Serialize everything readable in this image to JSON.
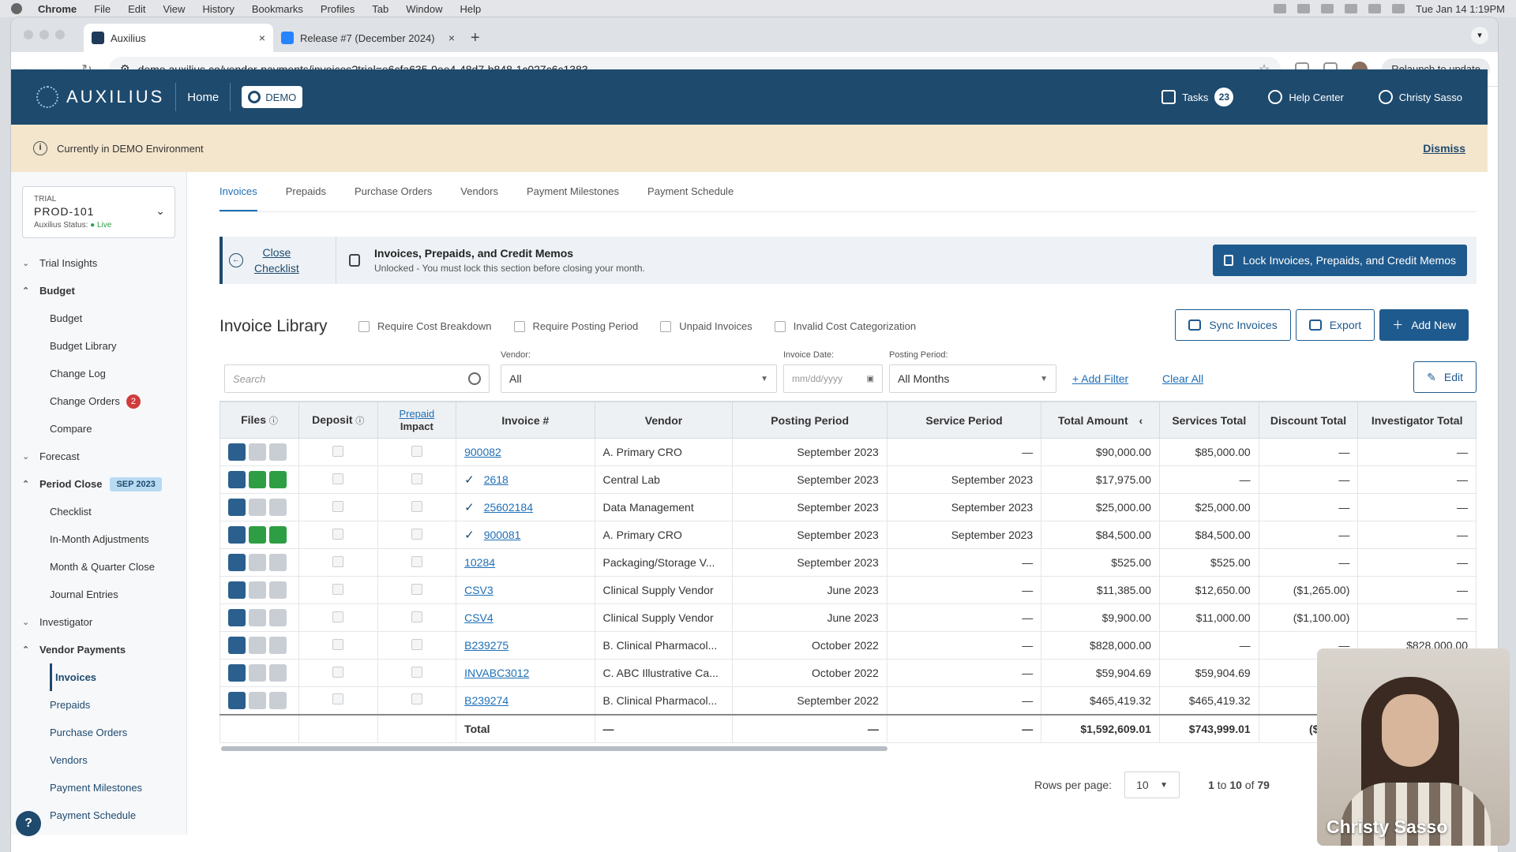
{
  "menubar": {
    "app": "Chrome",
    "items": [
      "File",
      "Edit",
      "View",
      "History",
      "Bookmarks",
      "Profiles",
      "Tab",
      "Window",
      "Help"
    ],
    "clock": "Tue Jan 14  1:19PM"
  },
  "browser": {
    "tabs": [
      {
        "title": "Auxilius",
        "close": "×"
      },
      {
        "title": "Release #7 (December 2024)",
        "close": "×"
      }
    ],
    "new_tab": "+",
    "url": "demo.auxilius.co/vendor-payments/invoices?trial=e6cfa635-9ee4-48d7-b848-1c027c6c1383",
    "relaunch": "Relaunch to update"
  },
  "header": {
    "logo": "AUXILIUS",
    "home": "Home",
    "demo": "DEMO",
    "tasks_label": "Tasks",
    "tasks_count": "23",
    "help": "Help Center",
    "user": "Christy Sasso"
  },
  "banner": {
    "text": "Currently in DEMO Environment",
    "dismiss": "Dismiss"
  },
  "sidebar": {
    "trial_label": "TRIAL",
    "trial_name": "PROD-101",
    "status_label": "Auxilius Status:",
    "status_value": "Live",
    "items": {
      "trial_insights": "Trial Insights",
      "budget": "Budget",
      "budget_sub": "Budget",
      "budget_library": "Budget Library",
      "change_log": "Change Log",
      "change_orders": "Change Orders",
      "change_orders_count": "2",
      "compare": "Compare",
      "forecast": "Forecast",
      "period_close": "Period Close",
      "period_badge": "SEP 2023",
      "checklist": "Checklist",
      "in_month": "In-Month Adjustments",
      "month_quarter": "Month & Quarter Close",
      "journal": "Journal Entries",
      "investigator": "Investigator",
      "vendor_payments": "Vendor Payments",
      "invoices": "Invoices",
      "prepaids": "Prepaids",
      "purchase_orders": "Purchase Orders",
      "vendors": "Vendors",
      "payment_milestones": "Payment Milestones",
      "payment_schedule": "Payment Schedule"
    },
    "help": "?"
  },
  "subtabs": [
    "Invoices",
    "Prepaids",
    "Purchase Orders",
    "Vendors",
    "Payment Milestones",
    "Payment Schedule"
  ],
  "lockbar": {
    "close_line1": "Close",
    "close_line2": "Checklist",
    "title": "Invoices, Prepaids, and Credit Memos",
    "subtitle": "Unlocked - You must lock this section before closing your month.",
    "button": "Lock Invoices, Prepaids, and Credit Memos"
  },
  "library": {
    "title": "Invoice Library",
    "checks": [
      "Require Cost Breakdown",
      "Require Posting Period",
      "Unpaid Invoices",
      "Invalid Cost Categorization"
    ],
    "sync": "Sync Invoices",
    "export": "Export",
    "add_new": "Add New",
    "edit": "Edit"
  },
  "filters": {
    "search_placeholder": "Search",
    "vendor_label": "Vendor:",
    "vendor_value": "All",
    "invoice_date_label": "Invoice Date:",
    "invoice_date_placeholder": "mm/dd/yyyy",
    "posting_label": "Posting Period:",
    "posting_value": "All Months",
    "add_filter": "+ Add Filter",
    "clear_all": "Clear All"
  },
  "table": {
    "columns": {
      "files": "Files",
      "deposit": "Deposit",
      "prepaid": "Prepaid",
      "impact": "Impact",
      "invoice": "Invoice #",
      "vendor": "Vendor",
      "posting": "Posting Period",
      "service": "Service Period",
      "total": "Total Amount",
      "services": "Services Total",
      "discount": "Discount Total",
      "investigator": "Investigator Total"
    },
    "rows": [
      {
        "dl": false,
        "csv": false,
        "checked": false,
        "invoice": "900082",
        "vendor": "A. Primary CRO",
        "posting": "September 2023",
        "service": "—",
        "total": "$90,000.00",
        "services": "$85,000.00",
        "discount": "—",
        "investigator": "—"
      },
      {
        "dl": true,
        "csv": true,
        "checked": true,
        "invoice": "2618",
        "vendor": "Central Lab",
        "posting": "September 2023",
        "service": "September 2023",
        "total": "$17,975.00",
        "services": "—",
        "discount": "—",
        "investigator": "—"
      },
      {
        "dl": false,
        "csv": false,
        "checked": true,
        "invoice": "25602184",
        "vendor": "Data Management",
        "posting": "September 2023",
        "service": "September 2023",
        "total": "$25,000.00",
        "services": "$25,000.00",
        "discount": "—",
        "investigator": "—"
      },
      {
        "dl": true,
        "csv": true,
        "checked": true,
        "invoice": "900081",
        "vendor": "A. Primary CRO",
        "posting": "September 2023",
        "service": "September 2023",
        "total": "$84,500.00",
        "services": "$84,500.00",
        "discount": "—",
        "investigator": "—"
      },
      {
        "dl": false,
        "csv": false,
        "checked": false,
        "invoice": "10284",
        "vendor": "Packaging/Storage V...",
        "posting": "September 2023",
        "service": "—",
        "total": "$525.00",
        "services": "$525.00",
        "discount": "—",
        "investigator": "—"
      },
      {
        "dl": false,
        "csv": false,
        "checked": false,
        "invoice": "CSV3",
        "vendor": "Clinical Supply Vendor",
        "posting": "June 2023",
        "service": "—",
        "total": "$11,385.00",
        "services": "$12,650.00",
        "discount": "($1,265.00)",
        "investigator": "—"
      },
      {
        "dl": false,
        "csv": false,
        "checked": false,
        "invoice": "CSV4",
        "vendor": "Clinical Supply Vendor",
        "posting": "June 2023",
        "service": "—",
        "total": "$9,900.00",
        "services": "$11,000.00",
        "discount": "($1,100.00)",
        "investigator": "—"
      },
      {
        "dl": false,
        "csv": false,
        "checked": false,
        "invoice": "B239275",
        "vendor": "B. Clinical Pharmacol...",
        "posting": "October 2022",
        "service": "—",
        "total": "$828,000.00",
        "services": "—",
        "discount": "—",
        "investigator": "$828,000.00"
      },
      {
        "dl": false,
        "csv": false,
        "checked": false,
        "invoice": "INVABC3012",
        "vendor": "C. ABC Illustrative Ca...",
        "posting": "October 2022",
        "service": "—",
        "total": "$59,904.69",
        "services": "$59,904.69",
        "discount": "",
        "investigator": ""
      },
      {
        "dl": false,
        "csv": false,
        "checked": false,
        "invoice": "B239274",
        "vendor": "B. Clinical Pharmacol...",
        "posting": "September 2022",
        "service": "—",
        "total": "$465,419.32",
        "services": "$465,419.32",
        "discount": "",
        "investigator": ""
      }
    ],
    "total_row": {
      "label": "Total",
      "vendor": "—",
      "posting": "—",
      "service": "—",
      "total": "$1,592,609.01",
      "services": "$743,999.01",
      "discount": "($2,365."
    }
  },
  "pager": {
    "rows_label": "Rows per page:",
    "rows_value": "10",
    "range_from": "1",
    "range_to": "10",
    "range_of": "79",
    "to_word": "to",
    "of_word": "of",
    "first": "|<"
  },
  "video": {
    "name": "Christy Sasso"
  },
  "colors": {
    "brand": "#1e4a6e",
    "accent": "#1e5a8e",
    "link": "#1e6fb6",
    "banner": "#f4e6cd",
    "success": "#2e9e44",
    "alert": "#d23b3b"
  }
}
